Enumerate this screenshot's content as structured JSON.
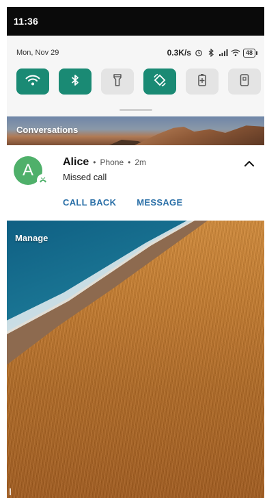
{
  "status_bar": {
    "time": "11:36"
  },
  "shade": {
    "date": "Mon, Nov 29",
    "net_speed": "0.3K/s",
    "battery": "48",
    "status_icons": [
      "alarm-icon",
      "bluetooth-icon",
      "signal-icon",
      "wifi-icon",
      "battery-icon"
    ],
    "tiles": [
      {
        "name": "wifi-tile",
        "icon": "wifi-icon",
        "on": true
      },
      {
        "name": "bluetooth-tile",
        "icon": "bluetooth-icon",
        "on": true
      },
      {
        "name": "flashlight-tile",
        "icon": "flashlight-icon",
        "on": false
      },
      {
        "name": "auto-rotate-tile",
        "icon": "rotate-icon",
        "on": true
      },
      {
        "name": "battery-saver-tile",
        "icon": "battery-saver-icon",
        "on": false
      },
      {
        "name": "screenshot-tile",
        "icon": "screenshot-icon",
        "on": false
      }
    ],
    "accent_on": "#1a8a74",
    "tile_off": "#e4e4e4"
  },
  "conversations": {
    "header": "Conversations"
  },
  "notification": {
    "avatar_letter": "A",
    "avatar_color": "#4fb06a",
    "sender": "Alice",
    "app": "Phone",
    "time": "2m",
    "separator": "•",
    "text": "Missed call",
    "actions": {
      "call_back": "CALL BACK",
      "message": "MESSAGE"
    },
    "action_color": "#2a6fa7"
  },
  "manage": {
    "label": "Manage"
  }
}
